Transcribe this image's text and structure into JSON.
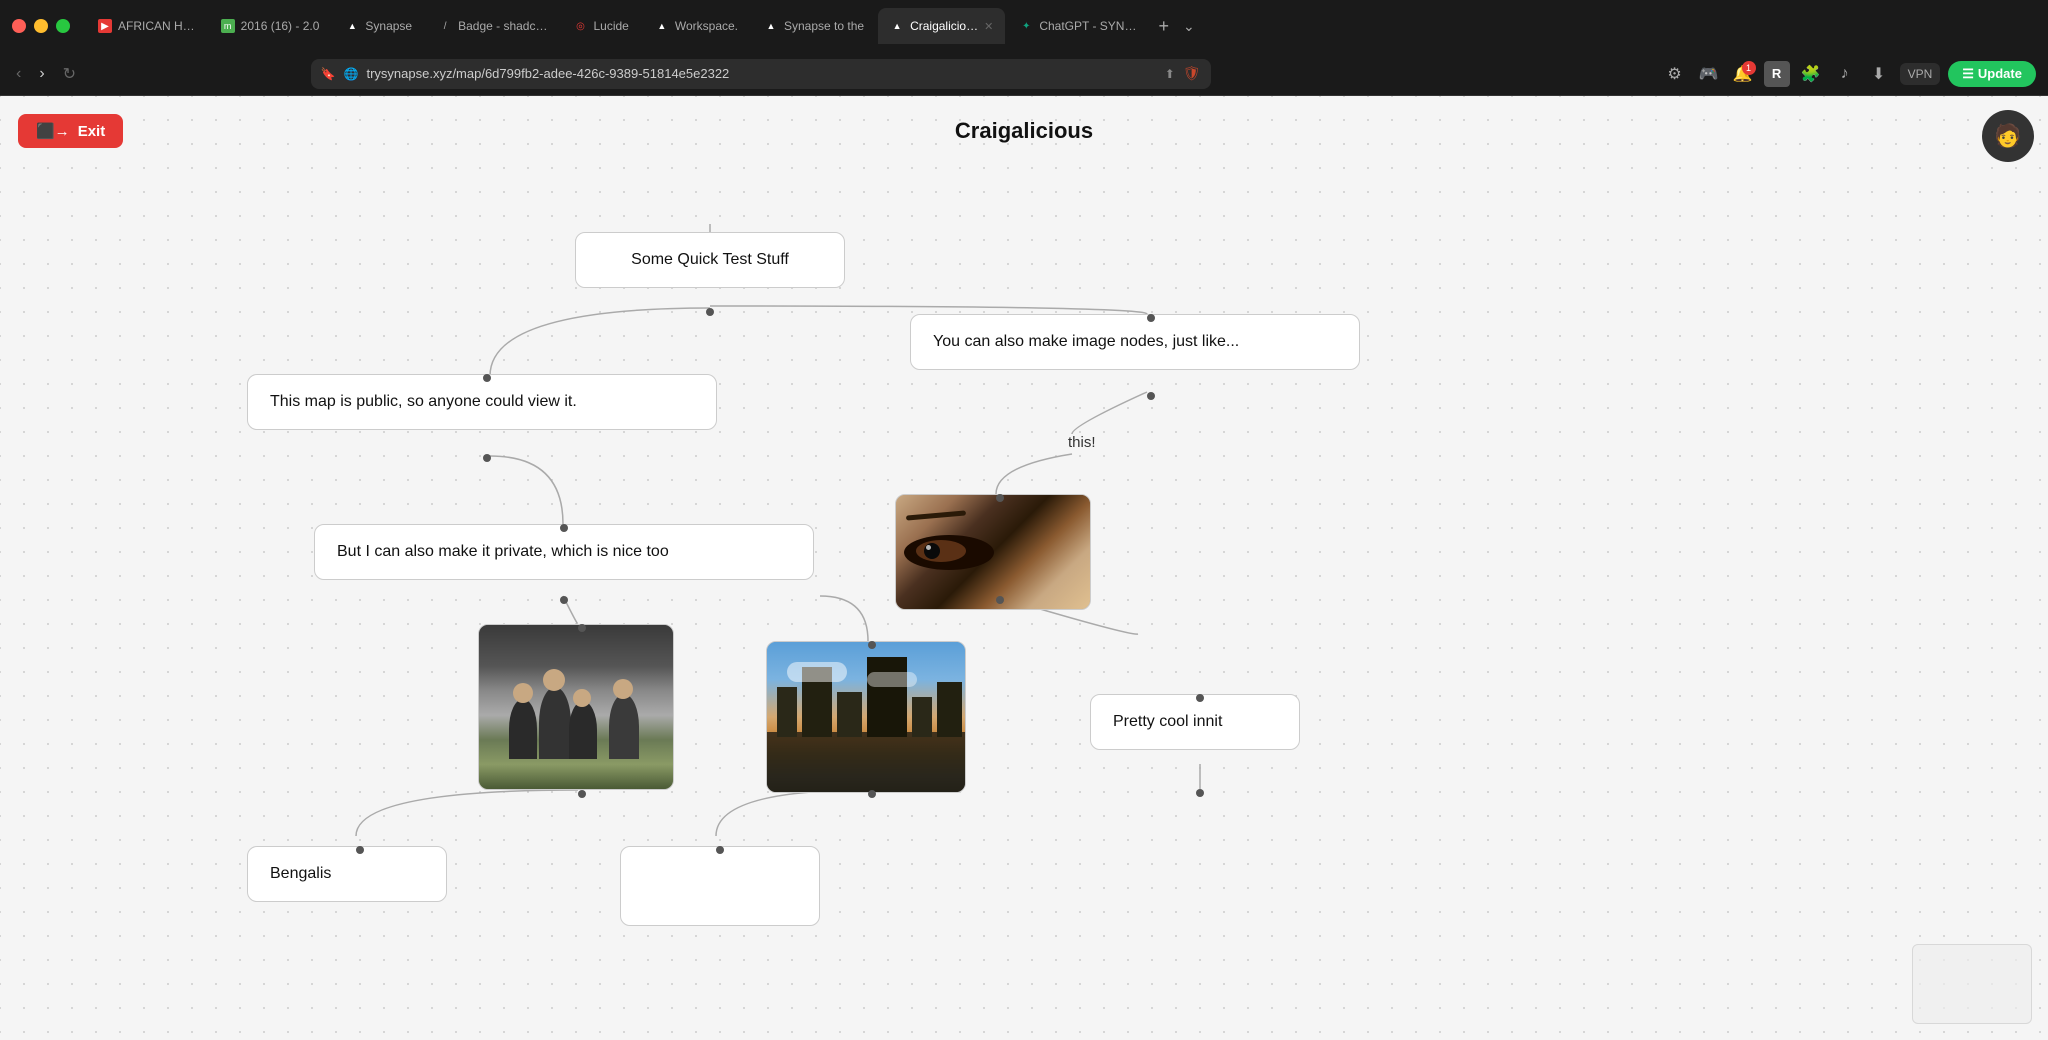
{
  "browser": {
    "tabs": [
      {
        "id": "tab-african",
        "label": "AFRICAN H…",
        "favicon_color": "#e53935",
        "favicon_char": "▶",
        "active": false
      },
      {
        "id": "tab-2016",
        "label": "2016 (16) - 2.0",
        "favicon_color": "#4caf50",
        "favicon_char": "m",
        "active": false
      },
      {
        "id": "tab-synapse",
        "label": "Synapse",
        "favicon_color": "#1a1a1a",
        "favicon_char": "▲",
        "active": false
      },
      {
        "id": "tab-badge",
        "label": "Badge - shadc…",
        "favicon_color": "#888",
        "favicon_char": "/",
        "active": false
      },
      {
        "id": "tab-lucide",
        "label": "Lucide",
        "favicon_color": "#e53935",
        "favicon_char": "◎",
        "active": false
      },
      {
        "id": "tab-workspace",
        "label": "Workspace.",
        "favicon_color": "#1a1a1a",
        "favicon_char": "▲",
        "active": false
      },
      {
        "id": "tab-synapse-to",
        "label": "Synapse to the",
        "favicon_color": "#1a1a1a",
        "favicon_char": "▲",
        "active": false
      },
      {
        "id": "tab-craigalicious",
        "label": "Craigalicio…",
        "favicon_color": "#1a1a1a",
        "favicon_char": "▲",
        "active": true
      },
      {
        "id": "tab-chatgpt",
        "label": "ChatGPT - SYN…",
        "favicon_color": "#10a37f",
        "favicon_char": "✦",
        "active": false
      }
    ],
    "url": "trysynapse.xyz/map/6d799fb2-adee-426c-9389-51814e5e2322",
    "update_label": "Update"
  },
  "canvas": {
    "title": "Craigalicious",
    "exit_label": "Exit",
    "nodes": [
      {
        "id": "node-quick-test",
        "text": "Some Quick Test Stuff",
        "type": "text"
      },
      {
        "id": "node-public",
        "text": "This map is public, so anyone could view it.",
        "type": "text"
      },
      {
        "id": "node-private",
        "text": "But I can also make it private, which is nice too",
        "type": "text"
      },
      {
        "id": "node-image-nodes",
        "text": "You can also make image nodes, just like...",
        "type": "text"
      },
      {
        "id": "node-this",
        "text": "this!",
        "type": "label"
      },
      {
        "id": "node-pretty-cool",
        "text": "Pretty cool innit",
        "type": "text"
      },
      {
        "id": "node-bengalis",
        "text": "Bengalis",
        "type": "text"
      },
      {
        "id": "node-eyes",
        "type": "image",
        "alt": "Close-up of eyes"
      },
      {
        "id": "node-group-photo",
        "type": "image",
        "alt": "Group photo"
      },
      {
        "id": "node-city",
        "type": "image",
        "alt": "City skyline"
      }
    ]
  }
}
